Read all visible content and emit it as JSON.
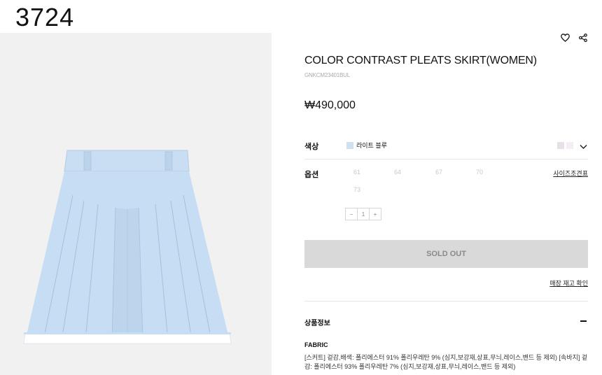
{
  "page_id": "3724",
  "product": {
    "title": "COLOR CONTRAST PLEATS SKIRT(WOMEN)",
    "code": "GNKCM23401BUL",
    "price": "₩490,000"
  },
  "actions": {
    "wishlist_icon": "heart-icon",
    "share_icon": "share-icon"
  },
  "color": {
    "label": "색상",
    "selected_name": "라이트 블루",
    "selected_swatch": "#cfe0f3",
    "other_swatches": [
      "#e9dfe6",
      "#f3eef3"
    ]
  },
  "option": {
    "label": "옵션",
    "sizes": [
      "61",
      "64",
      "67",
      "70",
      "73"
    ],
    "size_guide": "사이즈조견표",
    "quantity": {
      "minus": "−",
      "value": "1",
      "plus": "+"
    }
  },
  "soldout_label": "SOLD OUT",
  "store_stock_label": "매장 재고 확인",
  "details": {
    "title": "상품정보",
    "fabric_label": "FABRIC",
    "fabric_text": "[스커트] 겉감,배색: 폴리에스터 91% 폴리우레탄 9% (심지,보강재,상표,무늬,레이스,밴드 등 제외) [속바지] 겉감: 폴리에스터 93% 폴리우레탄 7% (심지,보강재,상표,무늬,레이스,밴드 등 제외)"
  },
  "colors": {
    "skirt": "#c7ddf4",
    "hem": "#ffffff",
    "soldout_bg": "#d9d9d9",
    "image_bg": "#f1f1f1"
  }
}
